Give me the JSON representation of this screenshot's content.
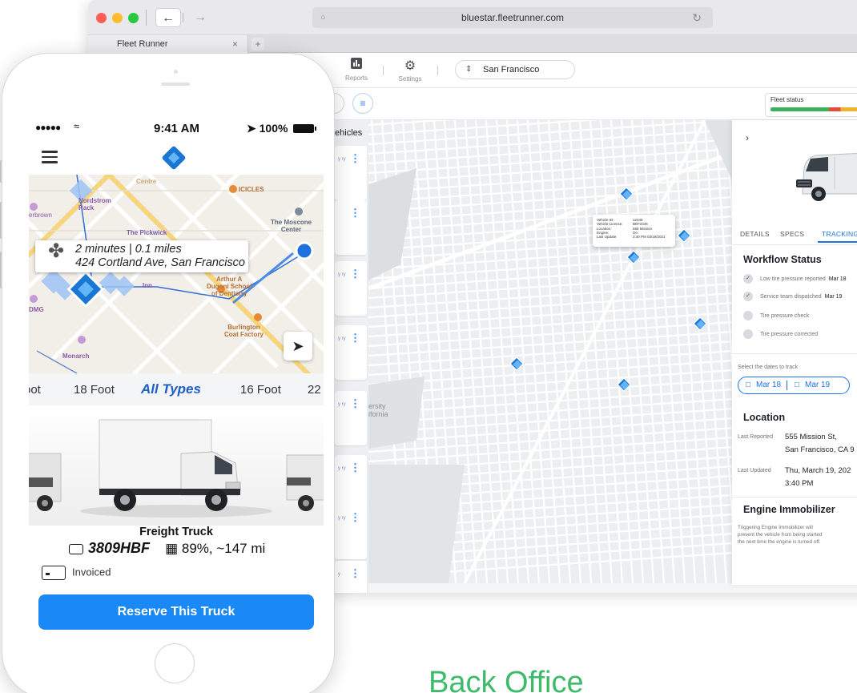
{
  "browser": {
    "url": "bluestar.fleetrunner.com",
    "tab_title": "Fleet Runner",
    "tab_close": "×",
    "new_tab": "+"
  },
  "toolbar": {
    "reports_label": "Reports",
    "settings_label": "Settings",
    "city": "San Francisco"
  },
  "fleet_status": {
    "label": "Fleet status",
    "count": "1,",
    "segments": [
      {
        "color": "#3cb15c",
        "fraction": 0.62
      },
      {
        "color": "#e64b3c",
        "fraction": 0.12
      },
      {
        "color": "#f1b230",
        "fraction": 0.26
      }
    ]
  },
  "vehicles_panel": {
    "header": "/ehicles",
    "card_fragments": [
      "y\nry",
      "",
      "y\nry",
      "y\nry",
      "y\nry",
      "y\nry",
      "y\nry",
      "y"
    ]
  },
  "map": {
    "popup": {
      "rows": [
        {
          "k": "Vehicle ID:",
          "v": "12345"
        },
        {
          "k": "Vehicle License:",
          "v": "BEF2345"
        },
        {
          "k": "Location:",
          "v": "555 Mission"
        },
        {
          "k": "Engine:",
          "v": "On"
        },
        {
          "k": "Last Update:",
          "v": "3:40 PM 03/19/2021"
        }
      ]
    },
    "label_university": "ersity\nifornia"
  },
  "details": {
    "tabs": [
      "DETAILS",
      "SPECS",
      "TRACKING"
    ],
    "active_tab": "TRACKING",
    "workflow_title": "Workflow Status",
    "workflow": [
      {
        "label": "Low tire pressure reported",
        "date": "Mar 18",
        "done": true
      },
      {
        "label": "Service team dispatched",
        "date": "Mar 19",
        "done": true
      },
      {
        "label": "Tire pressure check",
        "date": "",
        "done": false
      },
      {
        "label": "Tire pressure corrected",
        "date": "",
        "done": false
      }
    ],
    "dates_prompt": "Select the dates to track",
    "date_from": "Mar 18",
    "date_to": "Mar 19",
    "location_title": "Location",
    "last_reported_label": "Last Reported",
    "last_reported_value_1": "555 Mission St,",
    "last_reported_value_2": "San Francisco, CA 9",
    "last_updated_label": "Last Updated",
    "last_updated_value_1": "Thu, March 19, 202",
    "last_updated_value_2": "3:40 PM",
    "immobilizer_title": "Engine Immobilizer",
    "immobilizer_text_1": "Triggering Engine Immobilizer will",
    "immobilizer_text_2": "prevent the vehicle from being started",
    "immobilizer_text_3": "the next time the engine is turned off."
  },
  "caption": "Back Office",
  "phone": {
    "signal": "●●●●●",
    "time": "9:41 AM",
    "battery": "100%",
    "eta_line1": "2 minutes | 0.1 miles",
    "eta_line2": "424 Cortland Ave, San Francisco",
    "map_labels": {
      "icicles": "ICICLES",
      "moscone": "The Moscone\nCenter",
      "pickwick": "The Pickwick",
      "dugoni": "Arthur A\nDugoni School\nof Dentistry",
      "burlington": "Burlington\nCoat Factory",
      "monarch": "Monarch",
      "nordstrom": "Nordstrom\nRack",
      "centre": "Centre",
      "erbrown": "erbrown",
      "inn": "Inn",
      "dmg": "DMG"
    },
    "types": [
      "oot",
      "18 Foot",
      "All Types",
      "16 Foot",
      "22"
    ],
    "selected_type": "All Types",
    "truck_name": "Freight Truck",
    "plate": "3809HBF",
    "fuel": "89%, ~147 mi",
    "payment": "Invoiced",
    "reserve_button": "Reserve This Truck"
  }
}
